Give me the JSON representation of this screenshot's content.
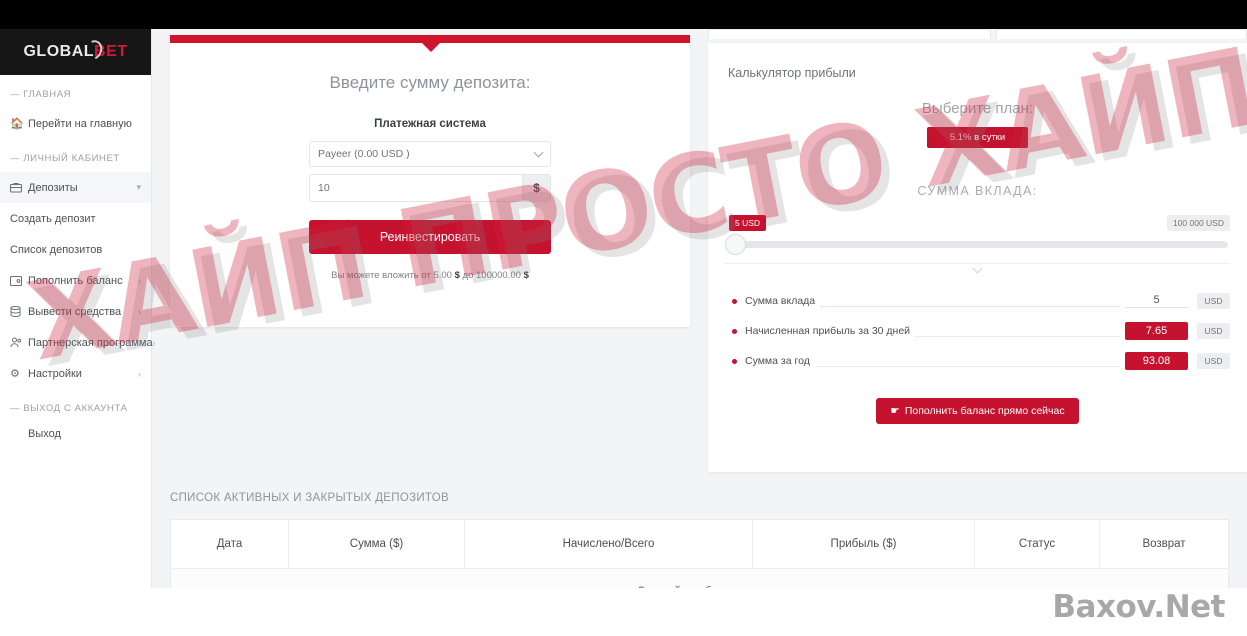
{
  "sidebar": {
    "logo": {
      "part1": "GLOBAL",
      "part2": "BET"
    },
    "section_main": "— ГЛАВНАЯ",
    "home_item": {
      "label": "Перейти на главную",
      "icon": "home-icon"
    },
    "section_account": "— ЛИЧНЫЙ КАБИНЕТ",
    "deposits": {
      "label": "Депозиты",
      "icon": "briefcase-icon",
      "arrow": "chevron-down-icon"
    },
    "sub_create": "Создать депозит",
    "sub_list": "Список депозитов",
    "topup": {
      "label": "Пополнить баланс",
      "icon": "card-icon",
      "arrow": "chevron-right-icon"
    },
    "withdraw": {
      "label": "Вывести средства",
      "icon": "database-icon",
      "arrow": "chevron-right-icon"
    },
    "partner": {
      "label": "Партнерская программа",
      "icon": "users-icon",
      "arrow": "chevron-right-icon"
    },
    "settings": {
      "label": "Настройки",
      "icon": "gear-icon",
      "arrow": "chevron-right-icon"
    },
    "section_logout": "— ВЫХОД С АККАУНТА",
    "logout": "Выход"
  },
  "deposit_form": {
    "title": "Введите сумму депозита:",
    "payment_label": "Платежная система",
    "payment_selected": "Payeer (0.00 USD )",
    "amount_value": "10",
    "amount_placeholder": "10",
    "currency_symbol": "$",
    "submit_label": "Реинвестировать",
    "hint_prefix": "Вы можете вложить от 5.00",
    "hint_cur1": "$",
    "hint_mid": "до 100000.00",
    "hint_cur2": "$"
  },
  "calculator": {
    "title": "Калькулятор прибыли",
    "plan_title": "Выберите план:",
    "plan_badge": "5.1% в сутки",
    "amount_title": "СУММА ВКЛАДА:",
    "slider_min": "5 USD",
    "slider_max": "100 000 USD",
    "rows": [
      {
        "label": "Сумма вклада",
        "value": "5",
        "unit": "USD",
        "highlight": false
      },
      {
        "label": "Начисленная прибыль за 30 дней",
        "value": "7.65",
        "unit": "USD",
        "highlight": true
      },
      {
        "label": "Сумма за год",
        "value": "93.08",
        "unit": "USD",
        "highlight": true
      }
    ],
    "topup_button": "Пополнить баланс прямо сейчас",
    "topup_icon": "hand-pointer-icon"
  },
  "deposit_list": {
    "title": "СПИСОК АКТИВНЫХ И ЗАКРЫТЫХ ДЕПОЗИТОВ",
    "columns": [
      "Дата",
      "Сумма ($)",
      "Начислено/Всего",
      "Прибыль ($)",
      "Статус",
      "Возврат"
    ],
    "empty_text": "Записей не обнаружено"
  },
  "watermarks": {
    "overlay": "ХАЙП ПРОСТО ХАЙП",
    "brand": "Baxov.Net"
  },
  "colors": {
    "accent_red": "#c4122f",
    "bar_red": "#cf142b",
    "logo_black": "#161616",
    "page_bg": "#f3f4f6"
  }
}
